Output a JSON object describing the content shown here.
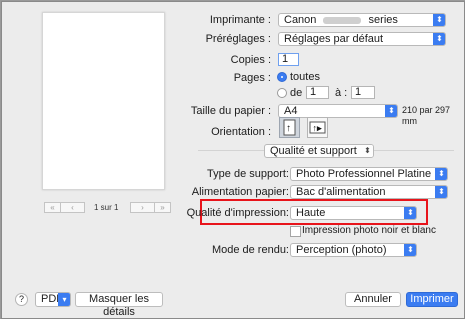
{
  "printer": {
    "label": "Imprimante :",
    "value": "Canon",
    "value_suffix": "series"
  },
  "presets": {
    "label": "Préréglages :",
    "value": "Réglages par défaut"
  },
  "copies": {
    "label": "Copies :",
    "value": "1"
  },
  "pages": {
    "label": "Pages :",
    "all_label": "toutes",
    "from_label": "de :",
    "from_value": "1",
    "to_label": "à :",
    "to_value": "1"
  },
  "paper_size": {
    "label": "Taille du papier :",
    "value": "A4",
    "dimensions": "210 par 297 mm"
  },
  "orientation": {
    "label": "Orientation :"
  },
  "section_popup": {
    "value": "Qualité et support"
  },
  "media_type": {
    "label": "Type de support:",
    "value": "Photo Professionnel Platine"
  },
  "paper_source": {
    "label": "Alimentation papier:",
    "value": "Bac d'alimentation"
  },
  "print_quality": {
    "label": "Qualité d'impression:",
    "value": "Haute",
    "highlight_color": "#e8141b"
  },
  "grayscale": {
    "label": "Impression photo noir et blanc",
    "checked": false
  },
  "rendering": {
    "label": "Mode de rendu:",
    "value": "Perception (photo)"
  },
  "preview_nav": {
    "page_info": "1 sur 1"
  },
  "footer": {
    "help_label": "?",
    "pdf_label": "PDF",
    "hide_details_label": "Masquer les détails",
    "cancel_label": "Annuler",
    "print_label": "Imprimer"
  },
  "colors": {
    "accent": "#3b7cf1",
    "dialog_bg": "#ececec"
  }
}
